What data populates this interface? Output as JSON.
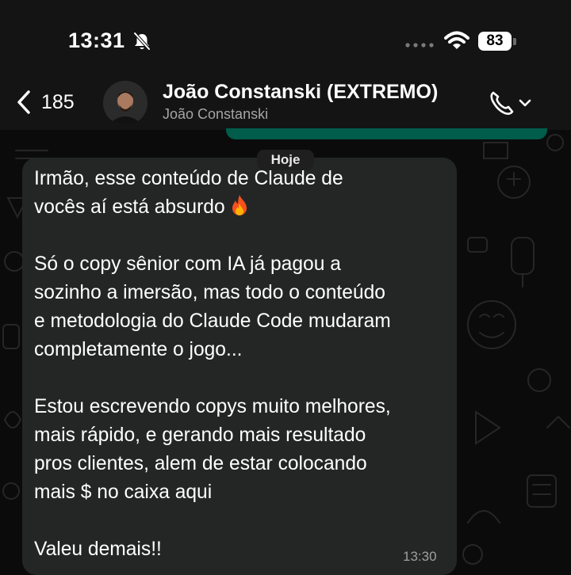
{
  "status_bar": {
    "time": "13:31",
    "battery": "83"
  },
  "header": {
    "back_count": "185",
    "contact_name": "João Constanski (EXTREMO)",
    "contact_subtitle": "João Constanski"
  },
  "chat": {
    "date_label": "Hoje",
    "message": {
      "text_before_emoji": "Irmão, esse conteúdo de Claude de\nvocês aí está absurdo ",
      "emoji": "fire-emoji",
      "text_after_emoji": "\n\nSó o copy sênior com IA já pagou a\nsozinho a imersão, mas todo o conteúdo\ne metodologia do Claude Code mudaram\ncompletamente o jogo...\n\nEstou escrevendo copys muito melhores,\nmais rápido, e gerando mais resultado\npros clientes, alem de estar colocando\nmais $ no caixa aqui\n\nValeu demais!!",
      "time": "13:30"
    }
  },
  "colors": {
    "background": "#0b0b0b",
    "bar": "#141414",
    "incoming_bubble": "#242626",
    "outgoing_bubble": "#005c4b",
    "secondary_text": "#a5a5a5"
  }
}
